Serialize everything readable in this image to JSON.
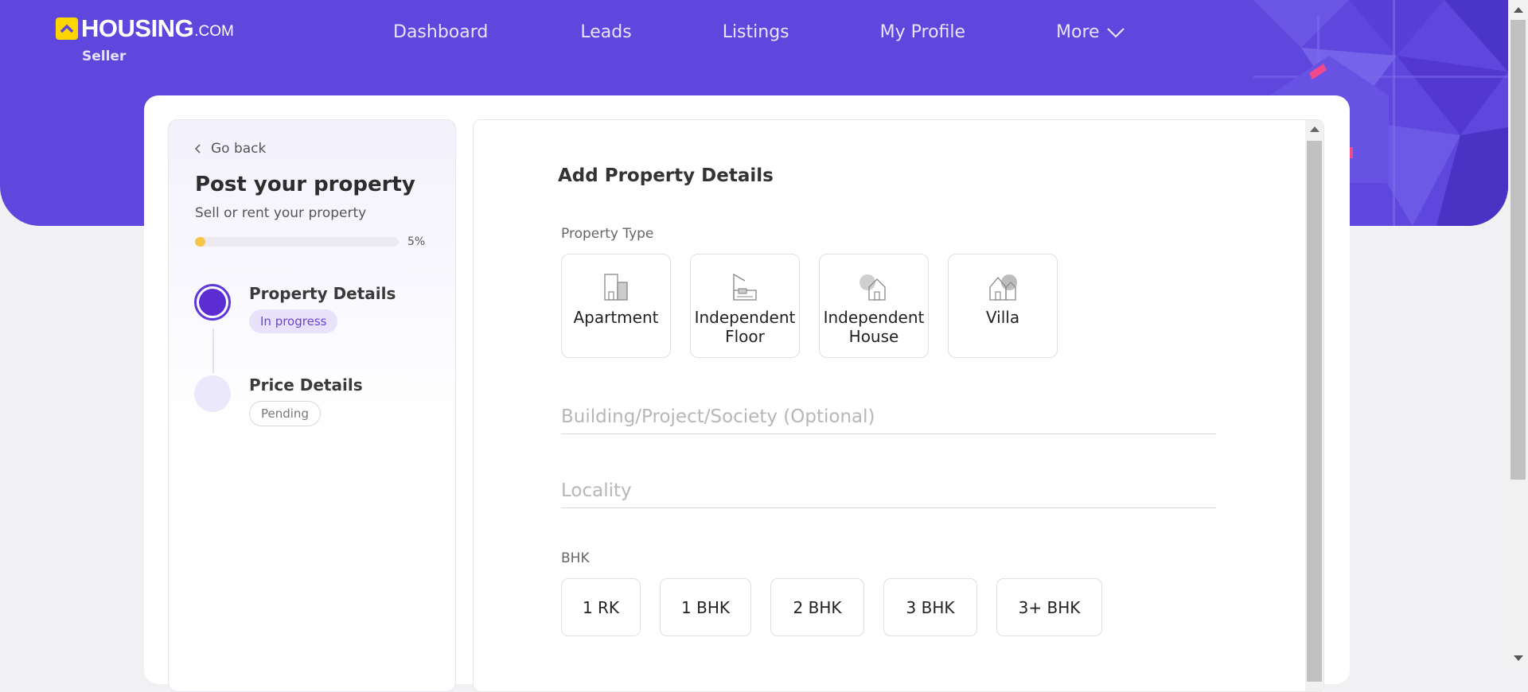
{
  "header": {
    "logo_text": "HOUSING",
    "logo_dotcom": ".COM",
    "logo_sub": "Seller",
    "nav": [
      {
        "label": "Dashboard"
      },
      {
        "label": "Leads"
      },
      {
        "label": "Listings"
      },
      {
        "label": "My Profile"
      },
      {
        "label": "More"
      }
    ]
  },
  "sidebar": {
    "go_back": "Go back",
    "title": "Post your property",
    "subtitle": "Sell or rent your property",
    "progress": {
      "percent": 5,
      "label": "5%"
    },
    "steps": [
      {
        "title": "Property Details",
        "status": "In progress"
      },
      {
        "title": "Price Details",
        "status": "Pending"
      }
    ]
  },
  "form": {
    "title": "Add Property Details",
    "property_type_label": "Property Type",
    "property_types": [
      {
        "label": "Apartment",
        "icon": "apartment-icon"
      },
      {
        "label": "Independent Floor",
        "icon": "independent-floor-icon"
      },
      {
        "label": "Independent House",
        "icon": "independent-house-icon"
      },
      {
        "label": "Villa",
        "icon": "villa-icon"
      }
    ],
    "building_placeholder": "Building/Project/Society (Optional)",
    "locality_placeholder": "Locality",
    "bhk_label": "BHK",
    "bhk_options": [
      "1 RK",
      "1 BHK",
      "2 BHK",
      "3 BHK",
      "3+ BHK"
    ]
  },
  "colors": {
    "brand_purple": "#5f47de",
    "accent_yellow": "#ffd500",
    "progress_fill": "#f7c548",
    "step_active": "#5b2dd3"
  }
}
